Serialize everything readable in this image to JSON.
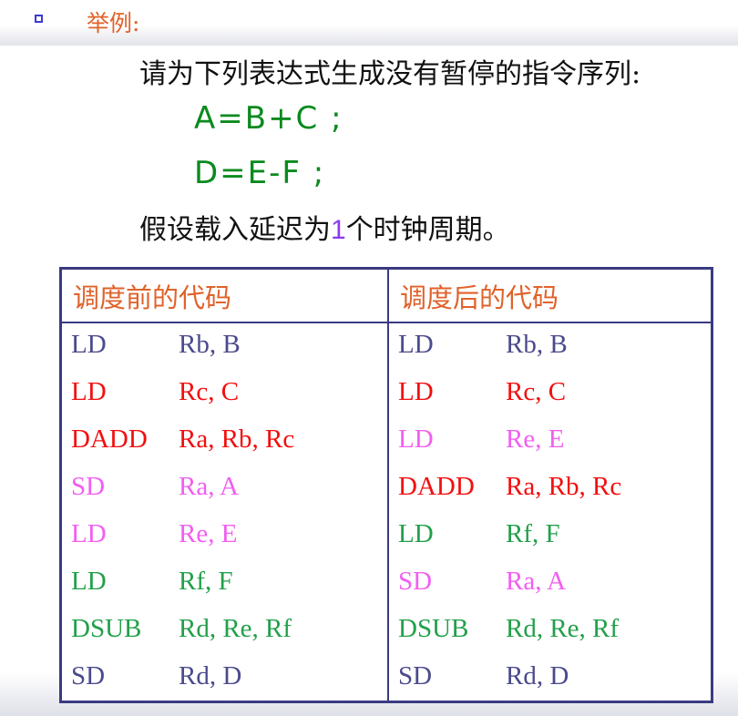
{
  "heading": "举例:",
  "prompt_line": "请为下列表达式生成没有暂停的指令序列:",
  "expressions": [
    "A=B+C ;",
    "D=E-F ;"
  ],
  "assumption": {
    "before": "假设载入延迟为",
    "number": "1",
    "after": "个时钟周期。"
  },
  "table": {
    "headers": [
      "调度前的代码",
      "调度后的代码"
    ],
    "before": [
      {
        "op": "LD",
        "args": "Rb, B",
        "color": "#4a4a8c"
      },
      {
        "op": "LD",
        "args": "Rc, C",
        "color": "#f20f0f"
      },
      {
        "op": "DADD",
        "args": "Ra, Rb, Rc",
        "color": "#f20f0f"
      },
      {
        "op": "SD",
        "args": "Ra, A",
        "color": "#f25ef2"
      },
      {
        "op": "LD",
        "args": "Re, E",
        "color": "#f25ef2"
      },
      {
        "op": "LD",
        "args": "Rf, F",
        "color": "#22a04a"
      },
      {
        "op": "DSUB",
        "args": "Rd, Re, Rf",
        "color": "#22a04a"
      },
      {
        "op": "SD",
        "args": "Rd, D",
        "color": "#4a4a8c"
      }
    ],
    "after": [
      {
        "op": "LD",
        "args": "Rb, B",
        "color": "#4a4a8c"
      },
      {
        "op": "LD",
        "args": "Rc, C",
        "color": "#f20f0f"
      },
      {
        "op": "LD",
        "args": "Re, E",
        "color": "#f25ef2"
      },
      {
        "op": "DADD",
        "args": "Ra, Rb, Rc",
        "color": "#f20f0f"
      },
      {
        "op": "LD",
        "args": "Rf, F",
        "color": "#22a04a"
      },
      {
        "op": "SD",
        "args": "Ra, A",
        "color": "#f25ef2"
      },
      {
        "op": "DSUB",
        "args": "Rd, Re, Rf",
        "color": "#22a04a"
      },
      {
        "op": "SD",
        "args": "Rd, D",
        "color": "#4a4a8c"
      }
    ]
  }
}
